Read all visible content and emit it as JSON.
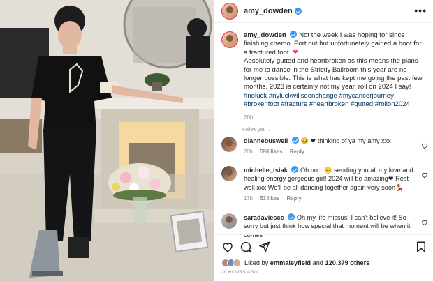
{
  "post": {
    "username": "amy_dowden",
    "more_icon": "more-horizontal-icon"
  },
  "caption": {
    "username": "amy_dowden",
    "p1": "Not the week I was hoping for since finishing chemo. Port out but unfortunately gained a boot for a fractured foot.",
    "p1_heart": "❤",
    "p2": "Absolutely gutted and heartbroken as this means the plans for me to dance in the Strictly Ballroom this year are no longer possible. This is what has kept me going the past few months. 2023 is certainly not my year, roll on 2024 I say!",
    "tags": "#noluck #nyluckwillsoonchange #mycancerjourney #brokenfoot #fracture #heartbroken #gutted #rollon2024",
    "time": "20h"
  },
  "follow_label": "Follow you",
  "comments": [
    {
      "username": "diannebuswell",
      "emoji": "🥺 ❤",
      "text": "thinking of ya my amy xxx",
      "time": "20h",
      "likes": "598 likes",
      "reply": "Reply",
      "verified": true
    },
    {
      "username": "michelle_tsiak",
      "text": "Oh no…😔 sending you all my love and healing energy gorgeous girl! 2024 will be amazing❤ Rest well xxx We'll be all dancing together again very soon💃",
      "time": "17h",
      "likes": "53 likes",
      "reply": "Reply",
      "verified": true
    },
    {
      "username": "saradaviescc",
      "text": "Oh my life missus! I can't believe it! So sorry but just think how special that moment will be when it comes",
      "verified": true
    }
  ],
  "likes": {
    "prefix": "Liked by",
    "user": "emmaleyfield",
    "middle": "and",
    "count": "120,379 others"
  },
  "posted_ago": "20 HOURS AGO",
  "colors": {
    "link": "#00376b",
    "verified": "#3897f0",
    "heart": "#ed4956",
    "muted": "#8e8e8e"
  }
}
